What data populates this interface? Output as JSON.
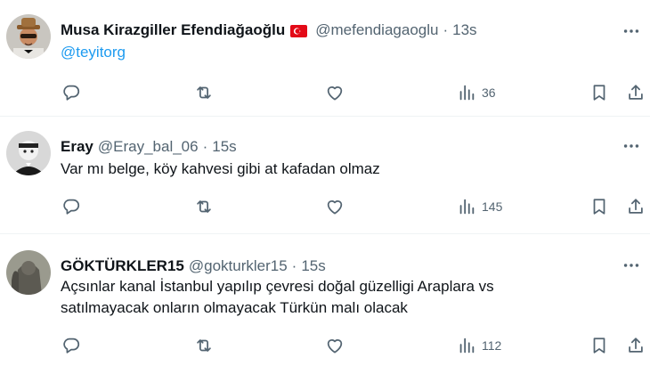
{
  "colors": {
    "accent": "#1d9bf0",
    "secondary_text": "#536471",
    "icon": "#536471",
    "divider": "#eff3f4"
  },
  "tweets": [
    {
      "name": "Musa Kirazgiller Efendiağaoğlu",
      "has_flag": true,
      "flag_icon": "turkey-flag-icon",
      "handle": "@mefendiagaoglu",
      "separator": "·",
      "time": "13s",
      "text": "@teyitorg",
      "views": "36"
    },
    {
      "name": "Eray",
      "handle": "@Eray_bal_06",
      "separator": "·",
      "time": "15s",
      "text": "Var mı belge, köy kahvesi gibi at kafadan olmaz",
      "views": "145"
    },
    {
      "name": "GÖKTÜRKLER15",
      "handle": "@gokturkler15",
      "separator": "·",
      "time": "15s",
      "text_line1": "Açsınlar kanal İstanbul yapılıp çevresi doğal güzelligi Araplara vs",
      "text_line2": "satılmayacak onların olmayacak Türkün malı olacak",
      "views": "112"
    }
  ],
  "icons": {
    "more": "more-horizontal-icon",
    "reply": "reply-icon",
    "retweet": "retweet-icon",
    "like": "heart-icon",
    "views": "views-bar-chart-icon",
    "bookmark": "bookmark-icon",
    "share": "share-icon"
  }
}
